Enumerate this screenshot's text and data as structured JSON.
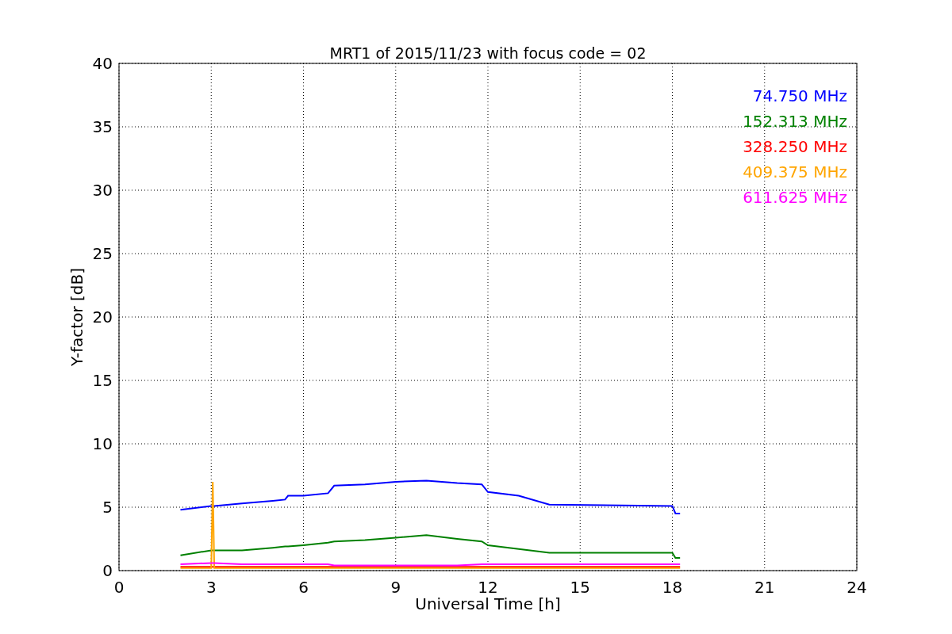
{
  "chart_data": {
    "type": "line",
    "title": "MRT1 of 2015/11/23 with focus code = 02",
    "xlabel": "Universal Time [h]",
    "ylabel": "Y-factor [dB]",
    "x": [
      2,
      3,
      3.05,
      3.1,
      4,
      5,
      5.4,
      5.5,
      6,
      6.8,
      7,
      8,
      9,
      10,
      11,
      11.8,
      12,
      13,
      14,
      18,
      18.1,
      18.25
    ],
    "series": [
      {
        "name": "74.750 MHz",
        "color": "#0000ff",
        "values": [
          4.8,
          5.1,
          5.1,
          5.1,
          5.3,
          5.5,
          5.6,
          5.9,
          5.9,
          6.1,
          6.7,
          6.8,
          7.0,
          7.1,
          6.9,
          6.8,
          6.2,
          5.9,
          5.2,
          5.1,
          4.5,
          4.5
        ]
      },
      {
        "name": "152.313 MHz",
        "color": "#008000",
        "values": [
          1.2,
          1.6,
          1.6,
          1.6,
          1.6,
          1.8,
          1.9,
          1.9,
          2.0,
          2.2,
          2.3,
          2.4,
          2.6,
          2.8,
          2.5,
          2.3,
          2.0,
          1.7,
          1.4,
          1.4,
          1.0,
          1.0
        ]
      },
      {
        "name": "328.250 MHz",
        "color": "#ff0000",
        "values": [
          0.3,
          0.3,
          0.3,
          0.3,
          0.3,
          0.3,
          0.3,
          0.3,
          0.3,
          0.3,
          0.3,
          0.3,
          0.3,
          0.3,
          0.3,
          0.3,
          0.3,
          0.3,
          0.3,
          0.3,
          0.3,
          0.3
        ]
      },
      {
        "name": "409.375 MHz",
        "color": "#ffa500",
        "values": [
          0.2,
          0.2,
          7.0,
          0.2,
          0.2,
          0.2,
          0.2,
          0.2,
          0.2,
          0.2,
          0.2,
          0.2,
          0.2,
          0.2,
          0.2,
          0.2,
          0.2,
          0.2,
          0.2,
          0.2,
          0.2,
          0.2
        ]
      },
      {
        "name": "611.625 MHz",
        "color": "#ff00ff",
        "values": [
          0.5,
          0.6,
          0.6,
          0.6,
          0.5,
          0.5,
          0.5,
          0.5,
          0.5,
          0.5,
          0.4,
          0.4,
          0.4,
          0.4,
          0.4,
          0.5,
          0.5,
          0.5,
          0.5,
          0.5,
          0.5,
          0.5
        ]
      }
    ],
    "grid": true,
    "xlim": [
      0,
      24
    ],
    "ylim": [
      0,
      40
    ],
    "xticks": [
      0,
      3,
      6,
      9,
      12,
      15,
      18,
      21,
      24
    ],
    "yticks": [
      0,
      5,
      10,
      15,
      20,
      25,
      30,
      35,
      40
    ]
  }
}
